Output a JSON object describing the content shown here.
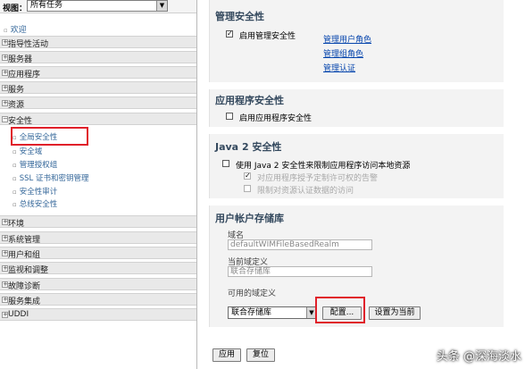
{
  "nav": {
    "view_label": "视图：",
    "view_value": "所有任务",
    "welcome": "欢迎",
    "categories": [
      "指导性活动",
      "服务器",
      "应用程序",
      "服务",
      "资源",
      "安全性",
      "环境",
      "系统管理",
      "用户和组",
      "监视和调整",
      "故障诊断",
      "服务集成",
      "UDDI"
    ],
    "security_items": [
      "全局安全性",
      "安全域",
      "管理授权组",
      "SSL 证书和密钥管理",
      "安全性审计",
      "总线安全性"
    ]
  },
  "admin_security": {
    "title": "管理安全性",
    "enable_label": "启用管理安全性",
    "enable_checked": true,
    "links": [
      "管理用户角色",
      "管理组角色",
      "管理认证"
    ]
  },
  "app_security": {
    "title": "应用程序安全性",
    "enable_label": "启用应用程序安全性",
    "enable_checked": false
  },
  "java2_security": {
    "title": "Java 2 安全性",
    "main_label": "使用 Java 2 安全性来限制应用程序访问本地资源",
    "sub1": "对应用程序授予定制许可权的告警",
    "sub2": "限制对资源认证数据的访问"
  },
  "user_registry": {
    "title": "用户帐户存储库",
    "realm_label": "域名",
    "realm_value": "defaultWIMFileBasedRealm",
    "current_label": "当前域定义",
    "current_value": "联合存储库",
    "available_label": "可用的域定义",
    "available_selected": "联合存储库",
    "configure_button": "配置...",
    "set_current_button": "设置为当前"
  },
  "footer": {
    "apply": "应用",
    "reset": "复位"
  },
  "watermark": "头条 @深海淡水"
}
